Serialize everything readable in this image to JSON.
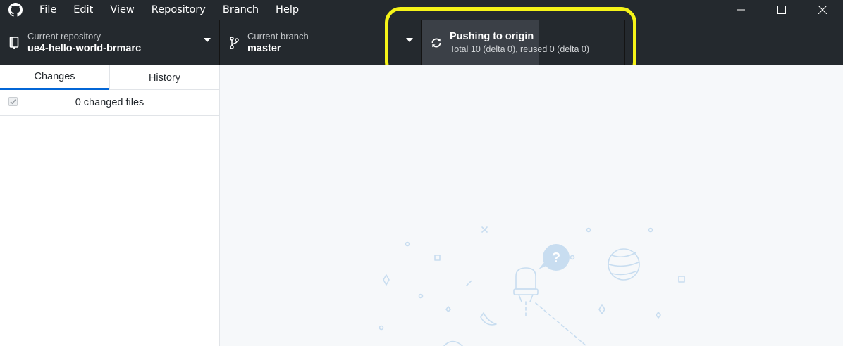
{
  "menu": {
    "items": [
      "File",
      "Edit",
      "View",
      "Repository",
      "Branch",
      "Help"
    ]
  },
  "window_controls": [
    "minimize-icon",
    "maximize-icon",
    "close-icon"
  ],
  "toolbar": {
    "repository": {
      "label": "Current repository",
      "value": "ue4-hello-world-brmarc"
    },
    "branch": {
      "label": "Current branch",
      "value": "master"
    },
    "push": {
      "title": "Pushing to origin",
      "description": "Total 10 (delta 0), reused 0 (delta 0)"
    }
  },
  "sidebar": {
    "tabs": [
      {
        "label": "Changes",
        "active": true
      },
      {
        "label": "History",
        "active": false
      }
    ],
    "changed_files": "0 changed files"
  },
  "colors": {
    "toolbar_bg": "#24292e",
    "push_bg": "#3b4047",
    "highlight": "#f5f318",
    "tab_accent": "#0366d6",
    "main_bg": "#f6f8fa",
    "illustration": "#c8ddf0"
  }
}
